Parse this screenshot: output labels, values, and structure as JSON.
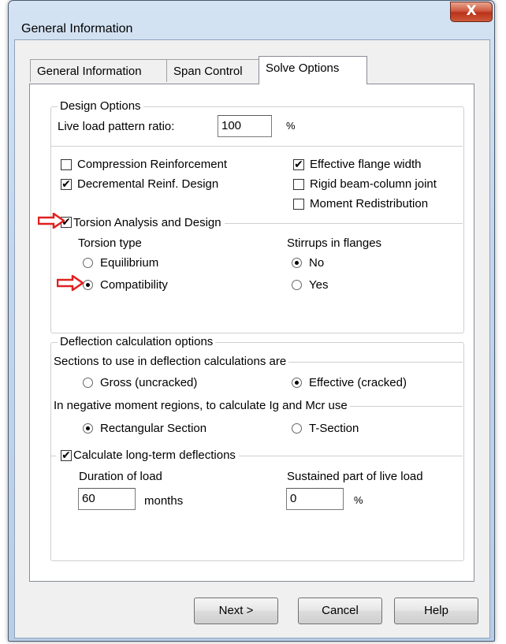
{
  "window": {
    "title": "General Information",
    "close_glyph": "X"
  },
  "tabs": [
    {
      "label": "General Information",
      "active": false
    },
    {
      "label": "Span Control",
      "active": false
    },
    {
      "label": "Solve Options",
      "active": true
    }
  ],
  "design_options": {
    "group_title": "Design Options",
    "live_load_label": "Live load pattern ratio:",
    "live_load_value": "100",
    "live_load_unit": "%",
    "compression_reinforcement": {
      "label": "Compression Reinforcement",
      "checked": false
    },
    "decremental_reinf": {
      "label": "Decremental Reinf. Design",
      "checked": true
    },
    "effective_flange_width": {
      "label": "Effective flange width",
      "checked": true
    },
    "rigid_beam_column": {
      "label": "Rigid beam-column joint",
      "checked": false
    },
    "moment_redistribution": {
      "label": "Moment Redistribution",
      "checked": false
    },
    "torsion_analysis": {
      "label": "Torsion Analysis and Design",
      "checked": true
    },
    "torsion_type_label": "Torsion type",
    "torsion_equilibrium": {
      "label": "Equilibrium",
      "selected": false
    },
    "torsion_compatibility": {
      "label": "Compatibility",
      "selected": true
    },
    "stirrups_label": "Stirrups in flanges",
    "stirrups_no": {
      "label": "No",
      "selected": true
    },
    "stirrups_yes": {
      "label": "Yes",
      "selected": false
    }
  },
  "deflection": {
    "group_title": "Deflection calculation options",
    "sections_label": "Sections to use in deflection calculations are",
    "gross": {
      "label": "Gross (uncracked)",
      "selected": false
    },
    "effective": {
      "label": "Effective (cracked)",
      "selected": true
    },
    "negative_moment_label": "In negative moment regions, to calculate Ig and Mcr use",
    "rectangular": {
      "label": "Rectangular Section",
      "selected": true
    },
    "tsection": {
      "label": "T-Section",
      "selected": false
    },
    "long_term": {
      "label": "Calculate long-term deflections",
      "checked": true
    },
    "duration_label": "Duration of load",
    "duration_value": "60",
    "duration_unit": "months",
    "sustained_label": "Sustained part of live load",
    "sustained_value": "0",
    "sustained_unit": "%"
  },
  "buttons": {
    "next": "Next >",
    "cancel": "Cancel",
    "help": "Help"
  },
  "colors": {
    "annotation_arrow": "#e02020",
    "close_button": "#c8462b"
  },
  "check_glyph": "✔"
}
